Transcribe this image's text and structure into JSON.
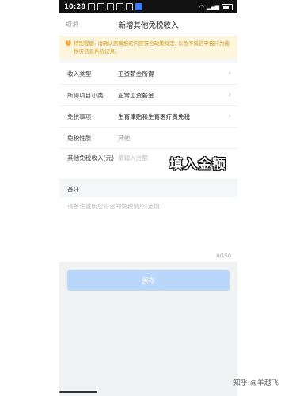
{
  "status": {
    "time": "10:28",
    "icons": [
      "notification-icon",
      "app-icon",
      "app-icon",
      "app-icon",
      "app-icon",
      "app-icon"
    ],
    "network": "wifi-icon signal-icon",
    "battery_icon": "battery-icon"
  },
  "nav": {
    "cancel": "取消",
    "title": "新增其他免税收入"
  },
  "notice": {
    "text": "特别提醒: 请确认您填报的内容符合政策规定, 以免不诚信申报行为被税务信息系统记录。"
  },
  "form": {
    "rows": [
      {
        "label": "收入类型",
        "value": "工资薪金所得"
      },
      {
        "label": "所得项目小类",
        "value": "正常工资薪金"
      },
      {
        "label": "免税事项",
        "value": "生育津贴和生育医疗费免税"
      },
      {
        "label": "免税性质",
        "value": "其他"
      },
      {
        "label": "其他免税收入(元)",
        "placeholder": "请输入金额"
      }
    ]
  },
  "overlay": {
    "text": "填入金额"
  },
  "remarks": {
    "label": "备注",
    "placeholder": "请备注说明您符合的免税情形(选填)",
    "counter": "0/150"
  },
  "actions": {
    "save": "保存"
  },
  "watermark": {
    "brand": "知乎 @羊越飞"
  }
}
